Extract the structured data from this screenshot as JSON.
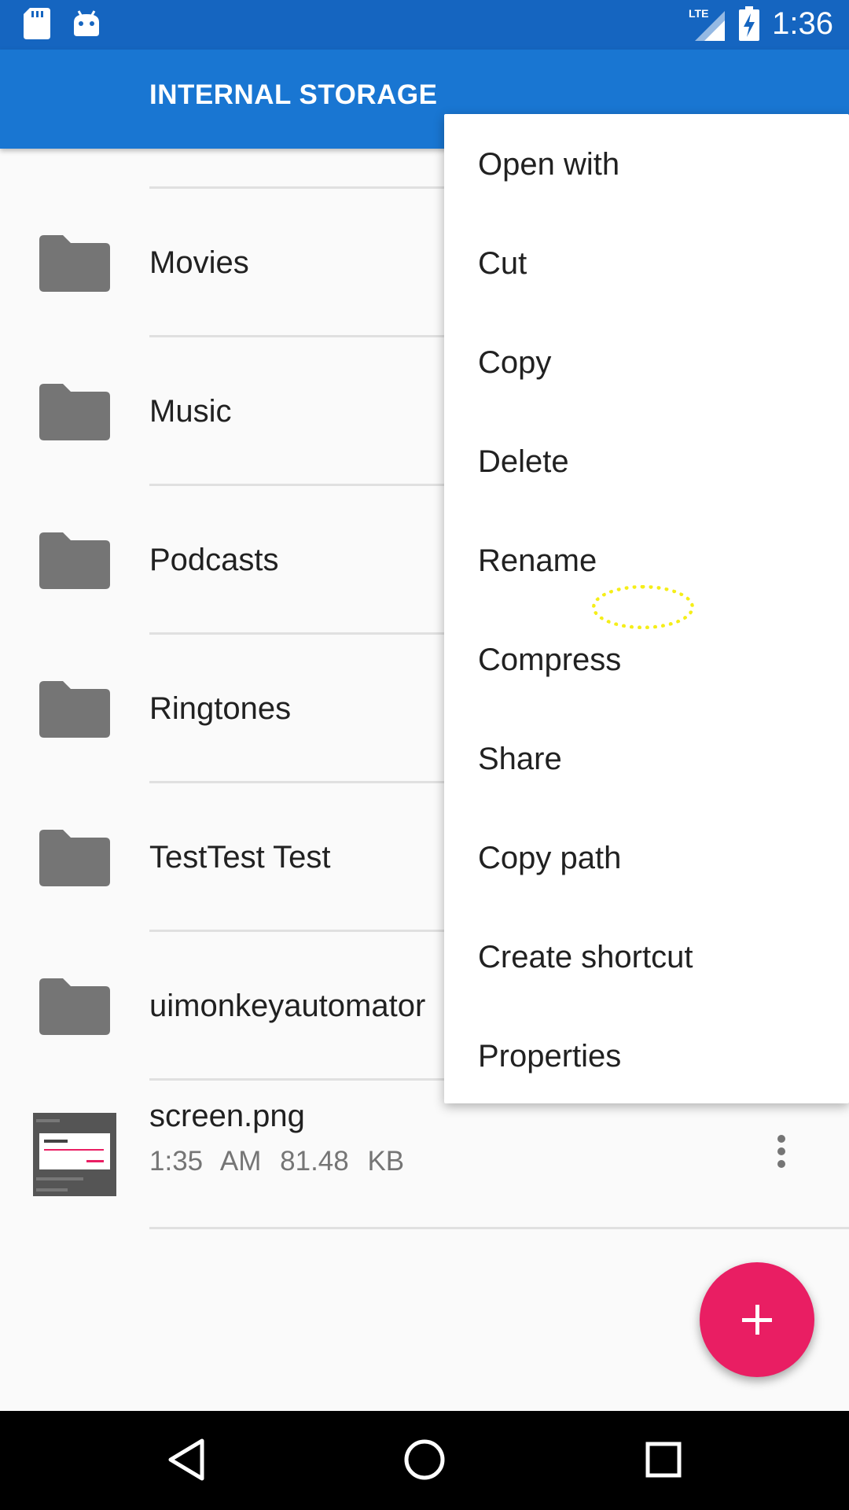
{
  "status_bar": {
    "time": "1:36",
    "network": "LTE",
    "icons": [
      "sd-card-icon",
      "android-icon",
      "lte-signal-icon",
      "battery-charging-icon"
    ]
  },
  "app_bar": {
    "title": "INTERNAL STORAGE"
  },
  "list": {
    "folders": [
      {
        "name": "Movies"
      },
      {
        "name": "Music"
      },
      {
        "name": "Podcasts"
      },
      {
        "name": "Ringtones"
      },
      {
        "name": "TestTest Test"
      },
      {
        "name": "uimonkeyautomator"
      }
    ],
    "file": {
      "name": "screen.png",
      "time": "1:35 AM",
      "size": "81.48 KB"
    }
  },
  "context_menu": {
    "items": [
      "Open with",
      "Cut",
      "Copy",
      "Delete",
      "Rename",
      "Compress",
      "Share",
      "Copy path",
      "Create shortcut",
      "Properties"
    ]
  },
  "fab": {
    "icon": "plus-icon"
  },
  "nav_bar": {
    "icons": [
      "back-icon",
      "home-icon",
      "recents-icon"
    ]
  },
  "colors": {
    "status_bar": "#1565c0",
    "app_bar": "#1976d2",
    "fab": "#e91e63",
    "folder_icon": "#757575",
    "touch_indicator": "#f5ee18"
  }
}
